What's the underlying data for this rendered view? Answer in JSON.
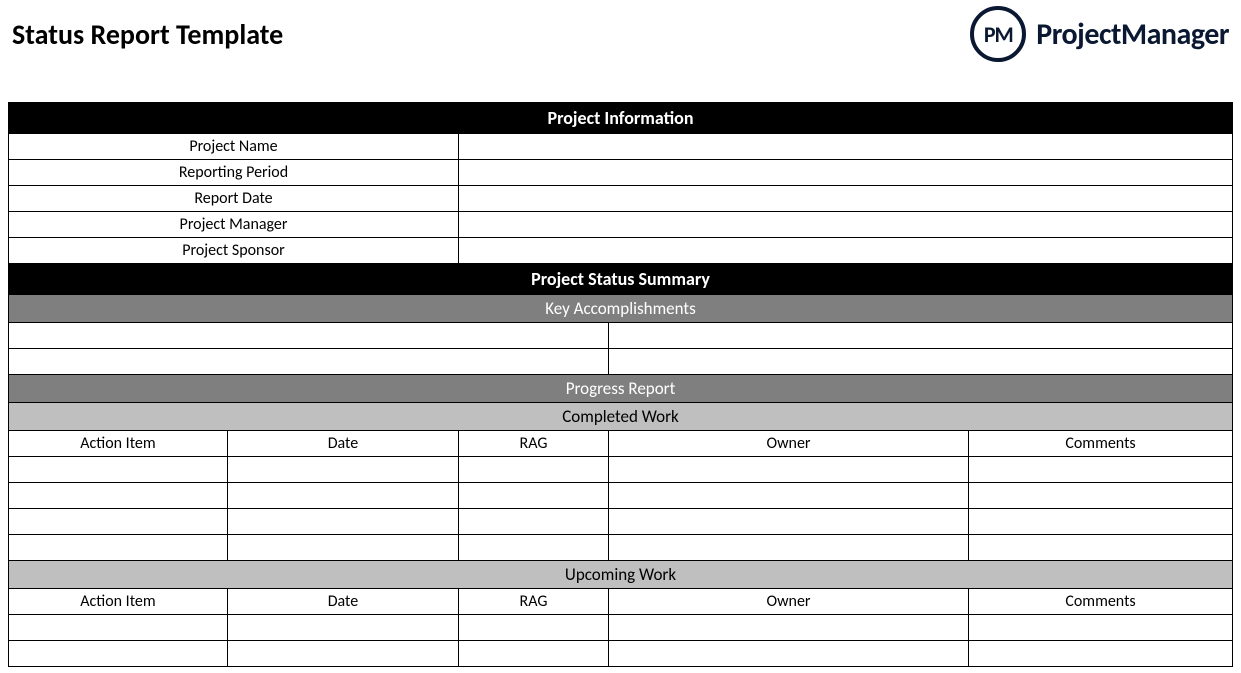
{
  "title": "Status Report Template",
  "brand": {
    "logo_text": "PM",
    "name": "ProjectManager"
  },
  "sections": {
    "project_info": {
      "header": "Project Information",
      "rows": [
        {
          "label": "Project Name",
          "value": ""
        },
        {
          "label": "Reporting Period",
          "value": ""
        },
        {
          "label": "Report Date",
          "value": ""
        },
        {
          "label": "Project Manager",
          "value": ""
        },
        {
          "label": "Project Sponsor",
          "value": ""
        }
      ]
    },
    "status_summary": {
      "header": "Project Status Summary",
      "key_accomplishments_header": "Key Accomplishments",
      "progress_report_header": "Progress Report",
      "completed_header": "Completed Work",
      "upcoming_header": "Upcoming Work",
      "columns": {
        "action": "Action Item",
        "date": "Date",
        "rag": "RAG",
        "owner": "Owner",
        "comments": "Comments"
      }
    }
  }
}
